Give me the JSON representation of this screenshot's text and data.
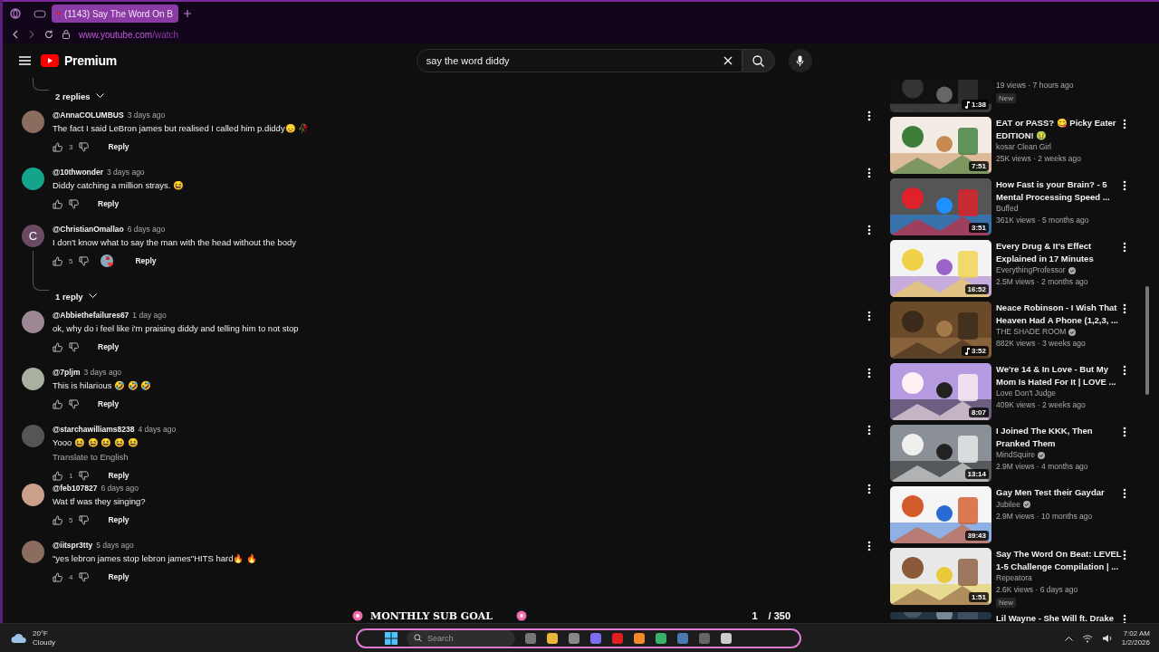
{
  "browser": {
    "tab": "(1143) Say The Word On B",
    "address": {
      "host": "www.youtube.com",
      "path": "/watch"
    }
  },
  "header": {
    "logo": "Premium",
    "search": {
      "value": "say the word diddy"
    }
  },
  "comments": [
    {
      "kind": "replies",
      "label": "2 replies"
    },
    {
      "kind": "comment",
      "author": "@AnnaCOLUMBUS",
      "time": "3 days ago",
      "text": "The fact I said LeBron james but realised I called him p.diddy😞 🥀",
      "likes": "3",
      "hearted": false,
      "reply": "Reply"
    },
    {
      "kind": "comment",
      "author": "@10thwonder",
      "time": "3 days ago",
      "text": "Diddy catching a million strays. 😆",
      "hearted": false,
      "reply": "Reply"
    },
    {
      "kind": "comment",
      "author": "@ChristianOmallao",
      "initial": "C",
      "time": "6 days ago",
      "text": "I don't know what to say the man with the head without the body",
      "likes": "5",
      "hearted": true,
      "reply": "Reply"
    },
    {
      "kind": "replies",
      "label": "1 reply"
    },
    {
      "kind": "comment",
      "author": "@Abbiethefailures67",
      "time": "1 day ago",
      "text": "ok, why do i feel like i'm praising diddy and telling him to not stop",
      "hearted": false,
      "reply": "Reply"
    },
    {
      "kind": "comment",
      "author": "@7pljm",
      "time": "3 days ago",
      "text": "This is hilarious 🤣 🤣 🤣",
      "hearted": false,
      "reply": "Reply"
    },
    {
      "kind": "comment",
      "author": "@starchawilliams8238",
      "time": "4 days ago",
      "text": "Yooo 😆 😆 😆 😆 😆",
      "translate": "Translate to English",
      "likes": "1",
      "hearted": false,
      "reply": "Reply"
    },
    {
      "kind": "comment",
      "author": "@feb107827",
      "time": "6 days ago",
      "text": "Wat tf was they singing?",
      "likes": "5",
      "hearted": false,
      "reply": "Reply"
    },
    {
      "kind": "comment",
      "author": "@iitspr3tty",
      "time": "5 days ago",
      "text": "\"yes lebron james stop lebron james\"HITS hard🔥 🔥",
      "likes": "4",
      "hearted": false,
      "reply": "Reply"
    }
  ],
  "videos": [
    {
      "meta": "19 views · 7 hours ago",
      "badge": "New",
      "duration": "1:38",
      "music": true
    },
    {
      "title": "EAT or PASS? 😋 Picky Eater EDITION! 🤢",
      "channel": "kosar Clean Girl",
      "verified": false,
      "meta": "25K views · 2 weeks ago",
      "duration": "7:51",
      "music": false
    },
    {
      "title": "How Fast is your Brain? - 5 Mental Processing Speed ...",
      "channel": "Buffed",
      "verified": false,
      "meta": "361K views · 5 months ago",
      "duration": "3:51",
      "music": false
    },
    {
      "title": "Every Drug & It's Effect Explained in 17 Minutes",
      "channel": "EverythingProfessor",
      "verified": true,
      "meta": "2.5M views · 2 months ago",
      "duration": "16:52",
      "music": false
    },
    {
      "title": "Neace Robinson - I Wish That Heaven Had A Phone (1,2,3, ...",
      "channel": "THE SHADE ROOM",
      "verified": true,
      "meta": "882K views · 3 weeks ago",
      "duration": "3:52",
      "music": true
    },
    {
      "title": "We're 14 & In Love - But My Mom Is Hated For It | LOVE ...",
      "channel": "Love Don't Judge",
      "verified": false,
      "meta": "409K views · 2 weeks ago",
      "duration": "8:07",
      "music": false
    },
    {
      "title": "I Joined The KKK, Then Pranked Them",
      "channel": "MindSquire",
      "verified": true,
      "meta": "2.9M views · 4 months ago",
      "duration": "13:14",
      "music": false
    },
    {
      "title": "Gay Men Test their Gaydar",
      "channel": "Jubilee",
      "verified": true,
      "meta": "2.9M views · 10 months ago",
      "duration": "39:43",
      "music": false
    },
    {
      "title": "Say The Word On Beat: LEVEL 1-5 Challenge Compilation | ...",
      "channel": "Repeatora",
      "verified": false,
      "meta": "2.6K views · 6 days ago",
      "badge": "New",
      "duration": "1:51",
      "music": false
    },
    {
      "title": "Lil Wayne - She Will ft. Drake"
    }
  ],
  "overlay": {
    "goal": "MONTHLY SUB GOAL",
    "count": "1",
    "total": "/ 350"
  },
  "taskbar": {
    "weather": {
      "temp": "20°F",
      "condition": "Cloudy"
    },
    "search": {
      "placeholder": "Search"
    },
    "time": "7:02 AM",
    "date": "1/2/2026"
  }
}
